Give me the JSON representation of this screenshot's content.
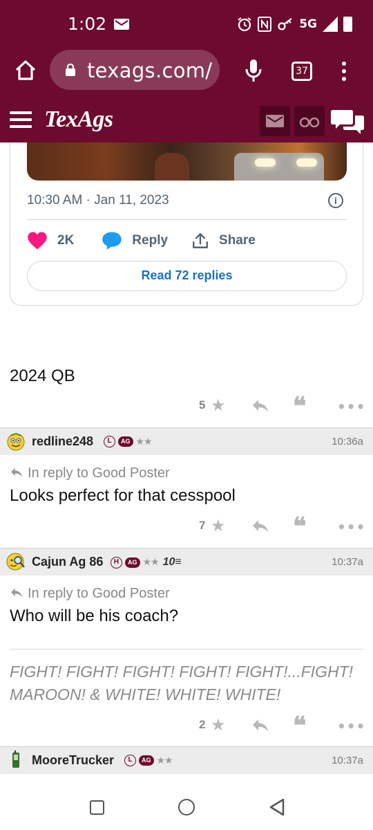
{
  "status": {
    "time": "1:02",
    "network": "5G",
    "notification_icon": "mail-icon"
  },
  "browser": {
    "url": "texags.com/",
    "tab_count": "37"
  },
  "site": {
    "logo": "TexAgs",
    "brand_color": "#6c0b2e"
  },
  "tweet": {
    "timestamp": "10:30 AM · Jan 11, 2023",
    "likes": "2K",
    "reply_label": "Reply",
    "share_label": "Share",
    "read_replies": "Read 72 replies"
  },
  "posts": [
    {
      "body": "2024 QB",
      "stars": "5"
    },
    {
      "username": "redline248",
      "badge": "L",
      "ag_badge": "AG",
      "rank_stars": "★★",
      "time": "10:36a",
      "in_reply_to": "In reply to Good Poster",
      "body": "Looks perfect for that cesspool",
      "stars": "7"
    },
    {
      "username": "Cajun Ag 86",
      "badge": "H",
      "ag_badge": "AG",
      "rank_stars": "★★",
      "extra_badge": "10≡",
      "time": "10:37a",
      "in_reply_to": "In reply to Good Poster",
      "body": "Who will be his coach?",
      "signature": "FIGHT! FIGHT! FIGHT! FIGHT! FIGHT!...FIGHT! MAROON! & WHITE! WHITE! WHITE!",
      "stars": "2"
    },
    {
      "username": "MooreTrucker",
      "badge": "L",
      "ag_badge": "AG",
      "rank_stars": "★★",
      "time": "10:37a"
    }
  ],
  "icons": {
    "star": "★",
    "quote": "❝",
    "more": "•••"
  }
}
